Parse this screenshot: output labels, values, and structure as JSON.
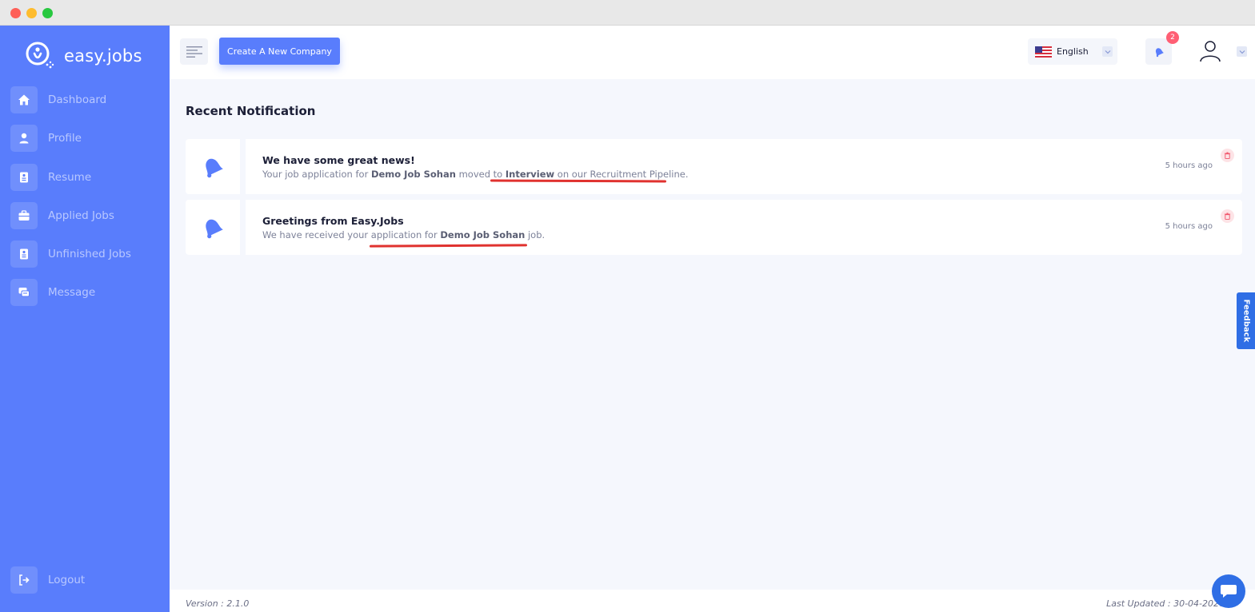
{
  "app": {
    "logo_text": "easy.jobs"
  },
  "sidebar": {
    "items": [
      {
        "label": "Dashboard",
        "icon": "home-icon"
      },
      {
        "label": "Profile",
        "icon": "user-icon"
      },
      {
        "label": "Resume",
        "icon": "resume-icon"
      },
      {
        "label": "Applied Jobs",
        "icon": "briefcase-icon"
      },
      {
        "label": "Unfinished Jobs",
        "icon": "document-icon"
      },
      {
        "label": "Message",
        "icon": "chat-icon"
      }
    ],
    "logout_label": "Logout"
  },
  "header": {
    "create_company_label": "Create A New Company",
    "language": "English",
    "notification_count": "2"
  },
  "page": {
    "title": "Recent Notification"
  },
  "notifications": [
    {
      "title": "We have some great news!",
      "text_1": "Your job application for ",
      "bold_1": "Demo Job Sohan",
      "text_2": " moved to ",
      "bold_2": "Interview",
      "text_3": " on our Recruitment Pipeline.",
      "time": "5 hours ago"
    },
    {
      "title": "Greetings from Easy.Jobs",
      "text_1": "We have received your application for ",
      "bold_1": "Demo Job Sohan",
      "text_2": " job.",
      "time": "5 hours ago"
    }
  ],
  "footer": {
    "version": "Version : 2.1.0",
    "last_updated": "Last Updated : 30-04-2020"
  },
  "widgets": {
    "feedback_label": "Feedback"
  },
  "colors": {
    "primary": "#597dfc",
    "badge": "#ff5f74",
    "annotation": "#e0322f",
    "widget": "#2f6ee5"
  }
}
